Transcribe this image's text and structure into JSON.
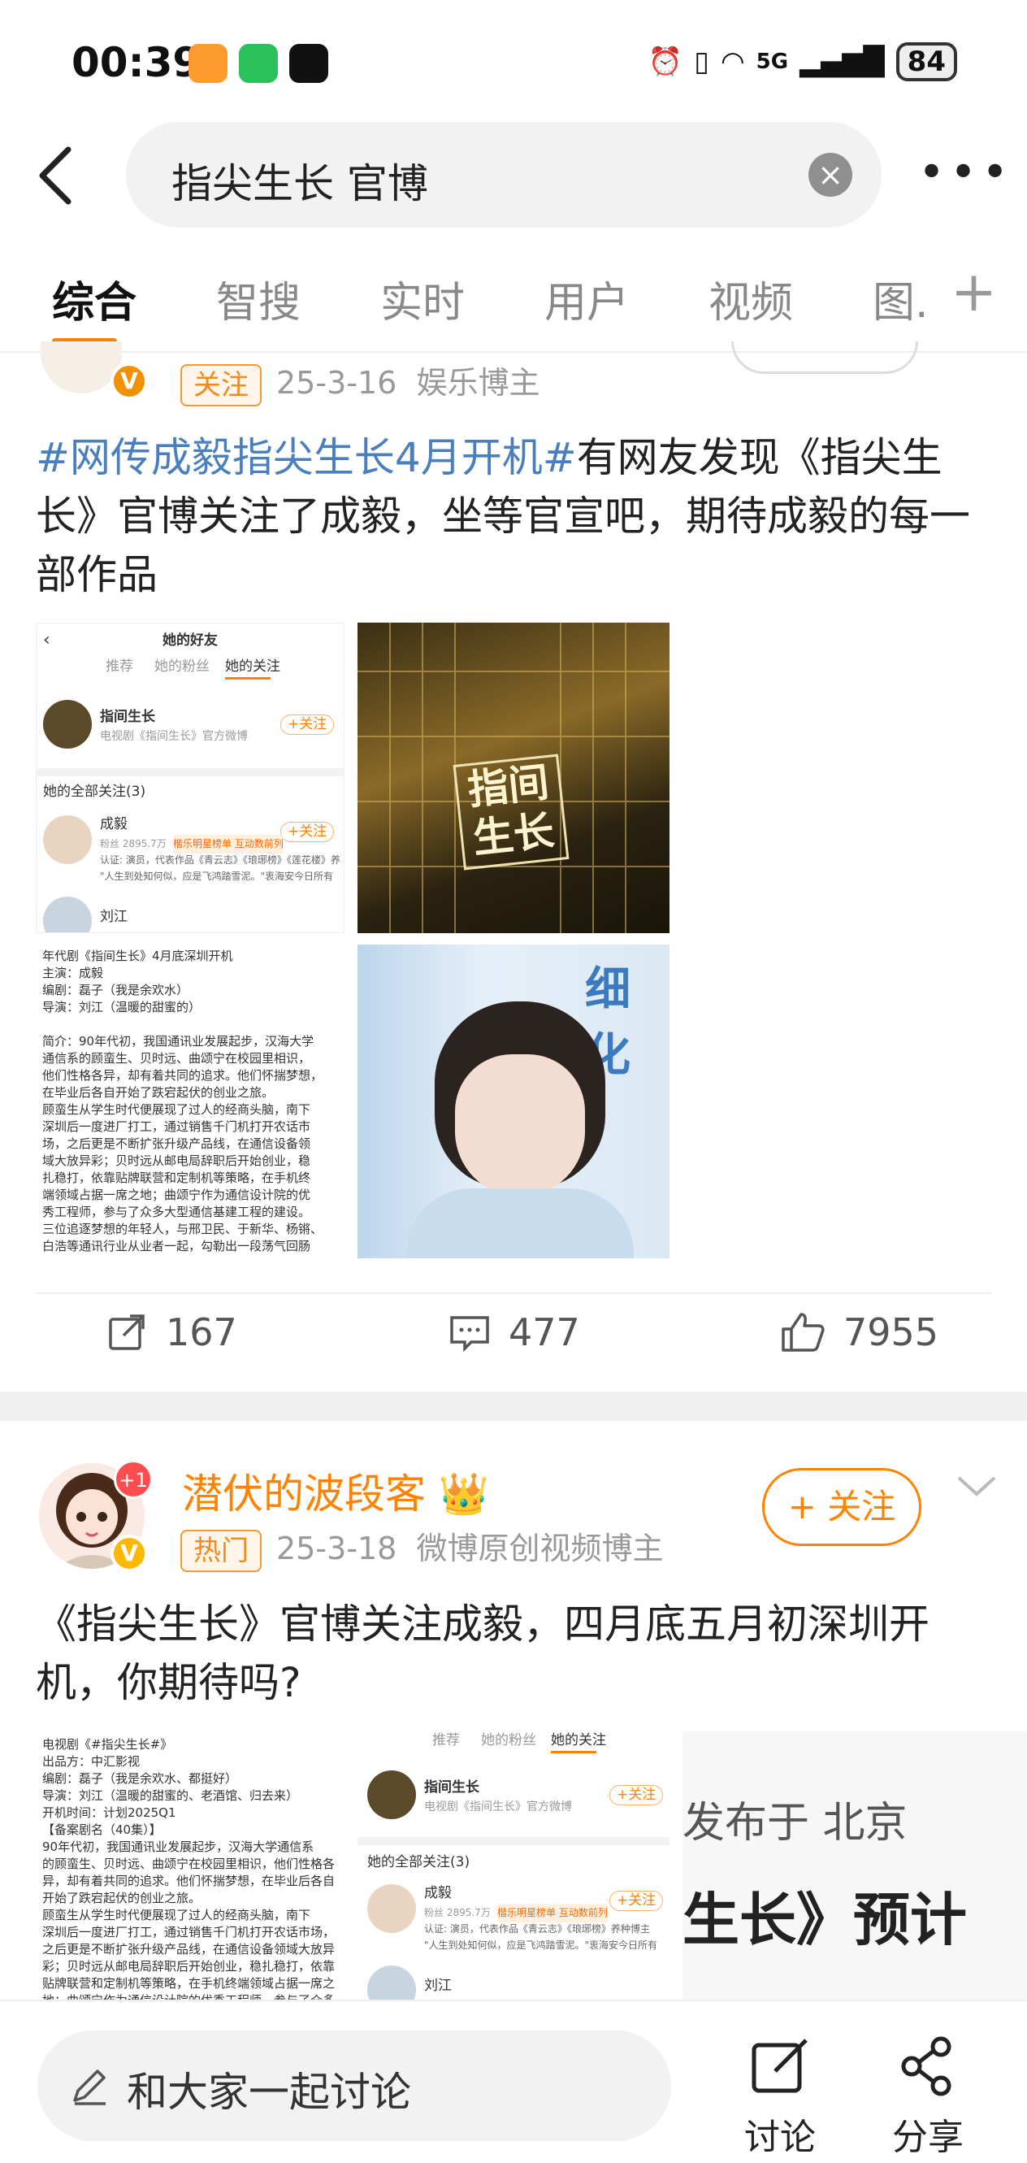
{
  "status": {
    "time": "00:39",
    "network": "5G",
    "battery": "84"
  },
  "search": {
    "query": "指尖生长 官博",
    "back_label": "<",
    "more_label": "•••"
  },
  "tabs": [
    {
      "label": "综合"
    },
    {
      "label": "智搜"
    },
    {
      "label": "实时"
    },
    {
      "label": "用户"
    },
    {
      "label": "视频"
    },
    {
      "label": "图."
    }
  ],
  "tabs_plus": "+",
  "post1": {
    "tag": "关注",
    "date": "25-3-16",
    "source": "娱乐博主",
    "hashtag": "#网传成毅指尖生长4月开机#",
    "text": "有网友发现《指尖生长》官博关注了成毅，坐等官宣吧，期待成毅的每一部作品",
    "img1": {
      "title": "她的好友",
      "tabs": [
        "推荐",
        "她的粉丝",
        "她的关注"
      ],
      "account_name": "指间生长",
      "account_desc": "电视剧《指间生长》官方微博",
      "follow": "+关注",
      "section": "她的全部关注(3)",
      "user1": "成毅",
      "user1_fans": "粉丝 2895.7万",
      "user1_tag": "楷乐明星榜单 互动数前列",
      "user1_auth": "认证: 演员，代表作品《青云志》《琅琊榜》《莲花楼》养种博主",
      "user1_quote": "\"人生到处知何似，应是飞鸿踏雪泥。\"衷海安今日所有",
      "user2": "刘江"
    },
    "img2_title": "指间生长",
    "img3": {
      "lines": [
        "年代剧《指间生长》4月底深圳开机",
        "主演：成毅",
        "编剧：磊子（我是余欢水）",
        "导演：刘江（温暖的甜蜜的）",
        "",
        "简介：90年代初，我国通讯业发展起步，汉海大学",
        "通信系的顾蛮生、贝时远、曲颂宁在校园里相识，",
        "他们性格各异，却有着共同的追求。他们怀揣梦想，",
        "在毕业后各自开始了跌宕起伏的创业之旅。",
        "顾蛮生从学生时代便展现了过人的经商头脑，南下",
        "深圳后一度进厂打工，通过销售千门机打开农话市",
        "场，之后更是不断扩张升级产品线，在通信设备领",
        "域大放异彩；贝时远从邮电局辞职后开始创业，稳",
        "扎稳打，依靠贴牌联营和定制机等策略，在手机终",
        "端领域占据一席之地；曲颂宁作为通信设计院的优",
        "秀工程师，参与了众多大型通信基建工程的建设。",
        "三位追逐梦想的年轻人，与邢卫民、于新华、杨锵、",
        "白浩等通讯行业从业者一起，勾勒出一段荡气回肠"
      ]
    },
    "img4_text": "细化",
    "reposts": "167",
    "comments": "477",
    "likes": "7955"
  },
  "post2": {
    "username": "潜伏的波段客",
    "badge_count": "+1",
    "tag": "热门",
    "date": "25-3-18",
    "source": "微博原创视频博主",
    "follow": "+ 关注",
    "text": "《指尖生长》官博关注成毅，四月底五月初深圳开机，你期待吗?",
    "img1": {
      "lines": [
        "电视剧《#指尖生长#》",
        "出品方：中汇影视",
        "编剧：磊子（我是余欢水、都挺好）",
        "导演：刘江（温暖的甜蜜的、老酒馆、归去来）",
        "开机时间：计划2025Q1",
        "【备案剧名（40集）】",
        "90年代初，我国通讯业发展起步，汉海大学通信系",
        "的顾蛮生、贝时远、曲颂宁在校园里相识，他们性格各",
        "异，却有着共同的追求。他们怀揣梦想，在毕业后各自",
        "开始了跌宕起伏的创业之旅。",
        "顾蛮生从学生时代便展现了过人的经商头脑，南下",
        "深圳后一度进厂打工，通过销售千门机打开农话市场，",
        "之后更是不断扩张升级产品线，在通信设备领域大放异",
        "彩；贝时远从邮电局辞职后开始创业，稳扎稳打，依靠",
        "贴牌联营和定制机等策略，在手机终端领域占据一席之",
        "地；曲颂宁作为通信设计院的优秀工程师，参与了众多"
      ]
    },
    "img2": {
      "tabs": [
        "推荐",
        "她的粉丝",
        "她的关注"
      ],
      "account_name": "指间生长",
      "account_desc": "电视剧《指间生长》官方微博",
      "follow": "+关注",
      "section": "她的全部关注(3)",
      "user1": "成毅",
      "user1_fans": "粉丝 2895.7万",
      "user1_tag": "楷乐明星榜单 互动数前列",
      "user1_auth": "认证: 演员，代表作品《青云志》《琅琊榜》养种博主",
      "user1_quote": "\"人生到处知何似，应是飞鸿踏雪泥。\"衷海安今日所有",
      "user2": "刘江"
    },
    "img3": {
      "line1": "发布于 北京",
      "line2": "生长》预计"
    }
  },
  "bottom": {
    "placeholder": "和大家一起讨论",
    "discuss": "讨论",
    "share": "分享"
  },
  "colors": {
    "accent": "#ff8200",
    "link": "#4a7fbe",
    "gray": "#999999"
  }
}
